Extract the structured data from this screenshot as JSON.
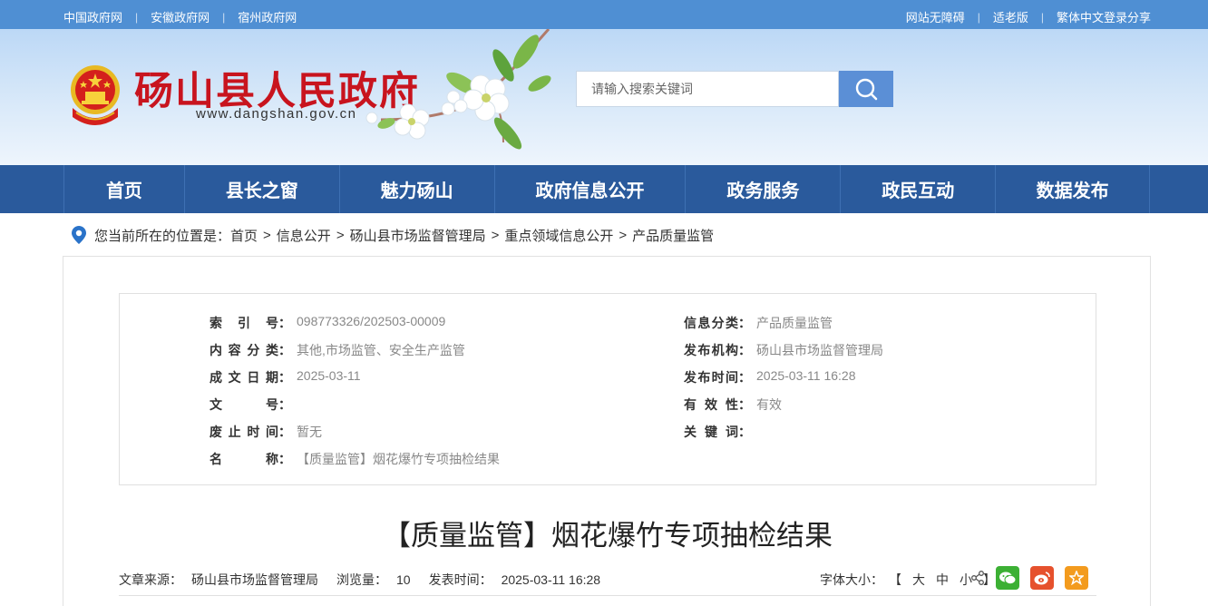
{
  "topbar": {
    "links": [
      "中国政府网",
      "安徽政府网",
      "宿州政府网"
    ],
    "right_links": [
      "网站无障碍",
      "适老版",
      "繁体中文登录分享"
    ]
  },
  "header": {
    "title": "砀山县人民政府",
    "url": "www.dangshan.gov.cn",
    "title_color": "#c8141e"
  },
  "search": {
    "placeholder": "请输入搜索关键词",
    "button_icon": "search-icon"
  },
  "nav": {
    "items": [
      "首页",
      "县长之窗",
      "魅力砀山",
      "政府信息公开",
      "政务服务",
      "政民互动",
      "数据发布"
    ],
    "bg_color": "#2a5a9c"
  },
  "breadcrumb": {
    "prefix": "您当前所在的位置是：",
    "items": [
      "首页",
      "信息公开",
      "砀山县市场监督管理局",
      "重点领域信息公开",
      "产品质量监管"
    ],
    "separator": ">"
  },
  "meta": {
    "left": [
      {
        "label": "索引号",
        "value": "098773326/202503-00009"
      },
      {
        "label": "内容分类",
        "value": "其他,市场监管、安全生产监管"
      },
      {
        "label": "成文日期",
        "value": "2025-03-11"
      },
      {
        "label": "文号",
        "value": ""
      },
      {
        "label": "废止时间",
        "value": "暂无"
      },
      {
        "label": "名称",
        "value": "【质量监管】烟花爆竹专项抽检结果"
      }
    ],
    "right": [
      {
        "label": "信息分类",
        "value": "产品质量监管"
      },
      {
        "label": "发布机构",
        "value": "砀山县市场监督管理局"
      },
      {
        "label": "发布时间",
        "value": "2025-03-11 16:28"
      },
      {
        "label": "有效性",
        "value": "有效"
      },
      {
        "label": "关键词",
        "value": ""
      }
    ]
  },
  "article": {
    "title": "【质量监管】烟花爆竹专项抽检结果",
    "source_label": "文章来源：",
    "source": "砀山县市场监督管理局",
    "views_label": "浏览量：",
    "views": "10",
    "time_label": "发表时间：",
    "time": "2025-03-11 16:28",
    "font_size_label": "字体大小：",
    "font_size_options": [
      "【",
      "大",
      "中",
      "小",
      "】"
    ]
  },
  "share": {
    "icons": [
      "share-icon",
      "wechat-icon",
      "weibo-icon",
      "favorite-icon"
    ],
    "colors": {
      "wechat": "#3cb034",
      "weibo": "#e6512d",
      "favorite": "#f39b1e"
    }
  }
}
